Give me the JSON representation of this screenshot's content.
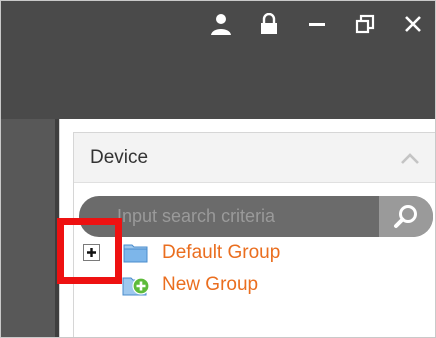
{
  "window": {
    "controls": [
      {
        "name": "user-icon"
      },
      {
        "name": "lock-icon"
      },
      {
        "name": "minimize-icon"
      },
      {
        "name": "restore-icon"
      },
      {
        "name": "close-icon"
      }
    ]
  },
  "device_panel": {
    "title": "Device",
    "collapse_icon": "chevron-up-icon"
  },
  "search": {
    "placeholder": "Input search criteria",
    "value": "",
    "icon": "search-icon"
  },
  "tree": {
    "items": [
      {
        "label": "Default Group",
        "icon": "folder-icon",
        "expander": "plus-icon",
        "expanded": false
      },
      {
        "label": "New Group",
        "icon": "add-group-icon"
      }
    ]
  },
  "colors": {
    "titlebar": "#4a4a4a",
    "tree_label": "#ea6e1f",
    "highlight": "#ee1111",
    "search_bg": "#6b6b6b"
  }
}
